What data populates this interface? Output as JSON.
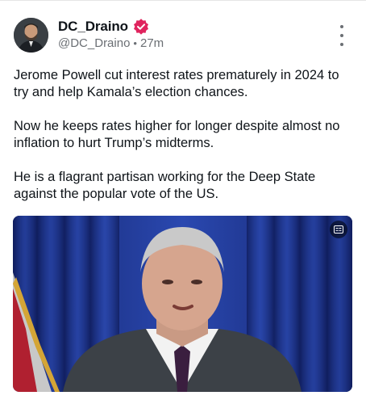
{
  "post": {
    "author": {
      "display_name": "DC_Draino",
      "handle": "@DC_Draino",
      "verified_icon": "verified-badge-icon",
      "verified_color": "#e0245e",
      "avatar_icon": "avatar"
    },
    "timestamp": "27m",
    "separator": "•",
    "paragraphs": [
      "Jerome Powell cut interest rates prematurely in 2024 to try and help Kamala’s election chances.",
      "Now he keeps rates higher for longer despite almost no inflation to hurt Trump’s midterms.",
      "He is a flagrant partisan working for the Deep State against the popular vote of the US."
    ],
    "menu_icon": "more-options-icon",
    "media": {
      "type": "video-thumbnail",
      "caption_icon": "closed-captions-icon"
    }
  },
  "colors": {
    "text": "#0f1419",
    "muted": "#6b6f74",
    "curtain": "#1f3a9a"
  }
}
